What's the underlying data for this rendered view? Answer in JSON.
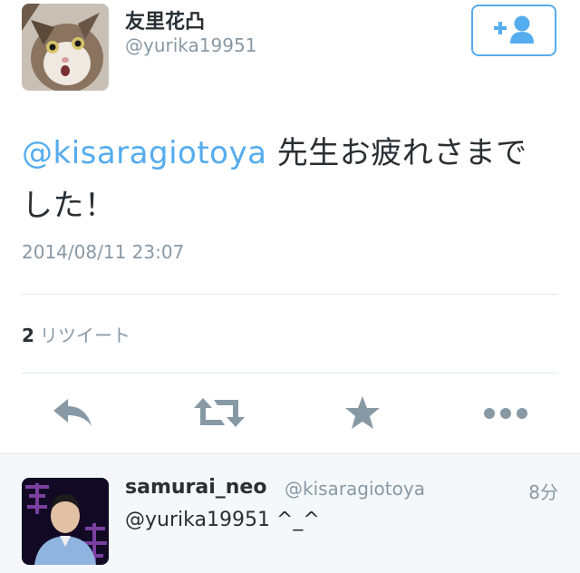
{
  "tweet": {
    "user_name": "友里花凸",
    "user_handle": "@yurika19951",
    "mention": "@kisaragiotoya",
    "text_line1": " 先生お疲れさまで",
    "text_line2": "した！",
    "timestamp": "2014/08/11 23:07",
    "retweet_count": "2",
    "retweet_label": "リツイート"
  },
  "reply": {
    "user_name": "samurai_neo",
    "user_handle": "@kisaragiotoya",
    "time": "8分",
    "text": "@yurika19951 ^_^"
  },
  "icons": {
    "follow": "add-user-icon",
    "reply": "reply-icon",
    "retweet": "retweet-icon",
    "favorite": "star-icon",
    "more": "more-icon"
  },
  "colors": {
    "accent": "#55acee",
    "icon_gray": "#8899a6",
    "text": "#292f33",
    "reply_bg": "#f5f8fa"
  }
}
